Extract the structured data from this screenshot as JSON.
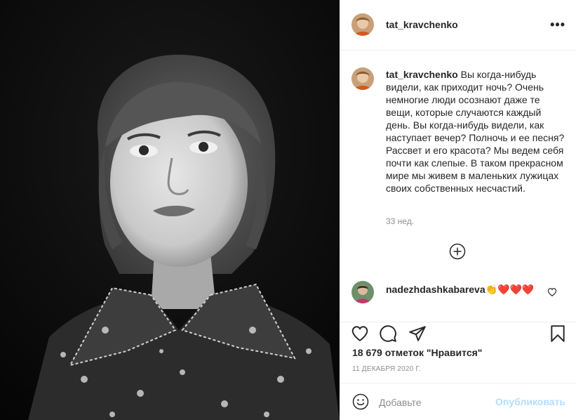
{
  "post": {
    "photo_alt": "Black and white portrait",
    "author": "tat_kravchenko",
    "more_label": "•••",
    "caption": "Вы когда-нибудь видели, как приходит ночь? Очень немногие люди осознают даже те вещи, которые случаются каждый день. Вы когда-нибудь видели, как наступает вечер? Полночь и ее песня? Рассвет и его красота? Мы ведем себя почти как слепые. В таком прекрасном мире мы живем в маленьких лужицах своих собственных несчастий.",
    "caption_time": "33 нед.",
    "likes": "18 679 отметок \"Нравится\"",
    "date": "11 ДЕКАБРЯ 2020 Г."
  },
  "comments": [
    {
      "user": "nadezhdashkabareva",
      "text": "👏❤️❤️❤️"
    }
  ],
  "add_comment": {
    "placeholder": "Добавьте",
    "publish_label": "Опубликовать"
  },
  "colors": {
    "primary_text": "#262626",
    "secondary_text": "#8e8e8e",
    "divider": "#efefef",
    "publish_disabled": "#b2dffc"
  },
  "icons": {
    "more": "more-options-icon",
    "load_more": "plus-circle-icon",
    "like": "heart-icon",
    "comment": "comment-bubble-icon",
    "share": "paper-plane-icon",
    "save": "bookmark-icon",
    "emoji": "emoji-smile-icon"
  }
}
